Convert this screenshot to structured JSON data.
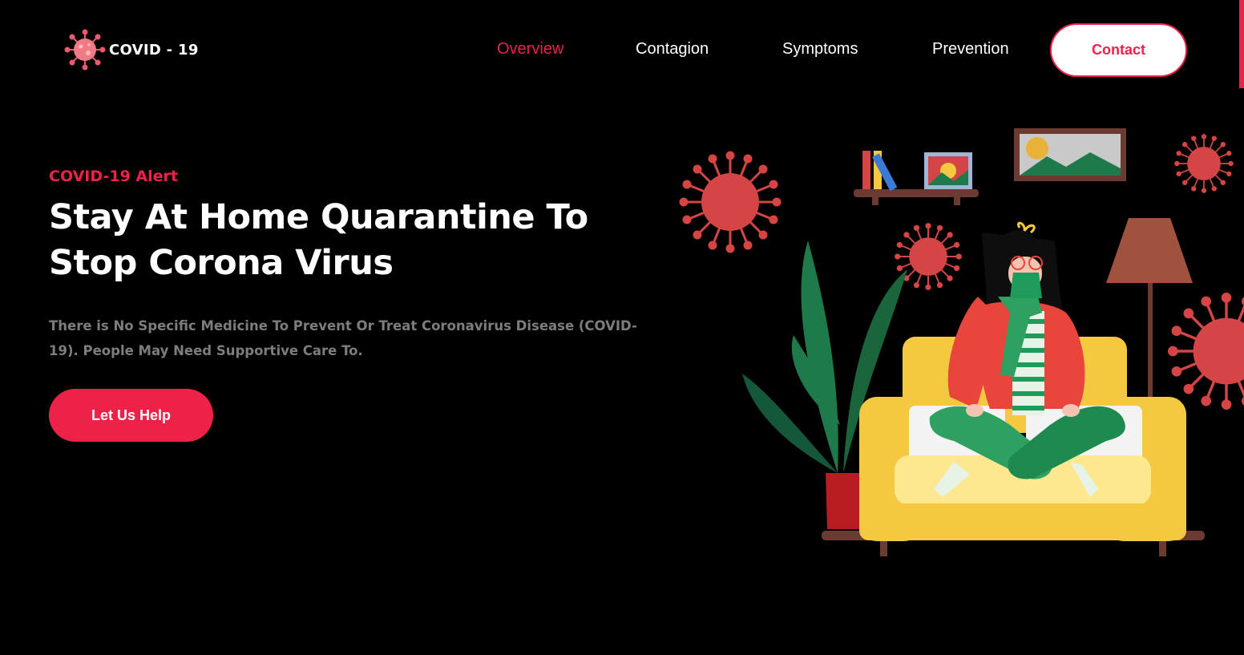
{
  "brand": {
    "name": "COVID - 19",
    "logo_icon": "virus-icon"
  },
  "nav": {
    "items": [
      {
        "label": "Overview",
        "active": true
      },
      {
        "label": "Contagion",
        "active": false
      },
      {
        "label": "Symptoms",
        "active": false
      },
      {
        "label": "Prevention",
        "active": false
      }
    ],
    "contact_label": "Contact"
  },
  "hero": {
    "alert": "COVID-19 Alert",
    "headline_line1": "Stay At Home Quarantine To",
    "headline_line2": "Stop Corona Virus",
    "description": "There is No Specific Medicine To Prevent Or Treat Coronavirus Disease (COVID-19). People May Need Supportive Care To.",
    "cta_label": "Let Us Help"
  },
  "colors": {
    "accent": "#ee2249",
    "background": "#000000",
    "muted_text": "#7d7d7d",
    "virus": "#d64545",
    "sofa": "#f5c842",
    "plant": "#1e7a4a"
  }
}
